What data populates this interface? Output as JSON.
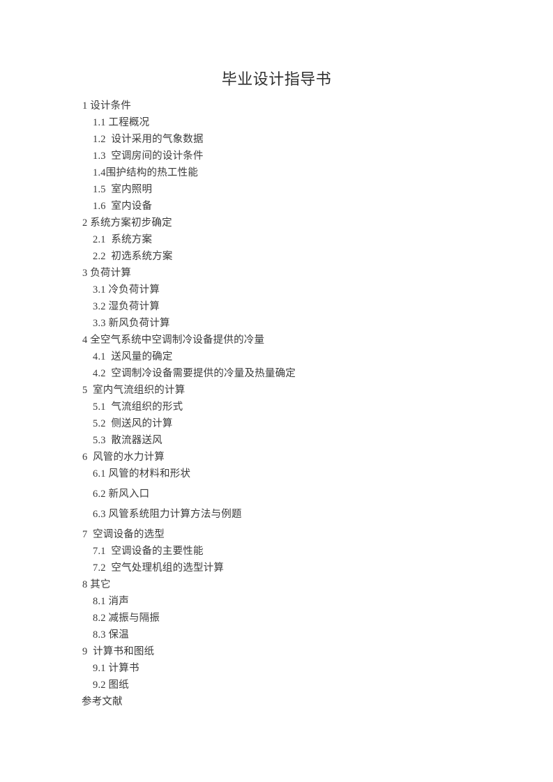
{
  "document": {
    "title": "毕业设计指导书",
    "toc": [
      {
        "text": "1 设计条件",
        "level": 1
      },
      {
        "text": "1.1 工程概况",
        "level": 2
      },
      {
        "text": "1.2  设计采用的气象数据",
        "level": 2
      },
      {
        "text": "1.3  空调房间的设计条件",
        "level": 2
      },
      {
        "text": "1.4围护结构的热工性能",
        "level": 2
      },
      {
        "text": "1.5  室内照明",
        "level": 2
      },
      {
        "text": "1.6  室内设备",
        "level": 2
      },
      {
        "text": "2 系统方案初步确定",
        "level": 1
      },
      {
        "text": "2.1  系统方案",
        "level": 2
      },
      {
        "text": "2.2  初选系统方案",
        "level": 2
      },
      {
        "text": "3 负荷计算",
        "level": 1
      },
      {
        "text": "3.1 冷负荷计算",
        "level": 2
      },
      {
        "text": "3.2 湿负荷计算",
        "level": 2
      },
      {
        "text": "3.3 新风负荷计算",
        "level": 2
      },
      {
        "text": "4 全空气系统中空调制冷设备提供的冷量",
        "level": 1
      },
      {
        "text": "4.1  送风量的确定",
        "level": 2
      },
      {
        "text": "4.2  空调制冷设备需要提供的冷量及热量确定",
        "level": 2
      },
      {
        "text": "5  室内气流组织的计算",
        "level": 1
      },
      {
        "text": "5.1  气流组织的形式",
        "level": 2
      },
      {
        "text": "5.2  侧送风的计算",
        "level": 2
      },
      {
        "text": "5.3  散流器送风",
        "level": 2
      },
      {
        "text": "6  风管的水力计算",
        "level": 1
      },
      {
        "text": "6.1 风管的材料和形状",
        "level": 2,
        "spacing": "gap-after"
      },
      {
        "text": "6.2 新风入口",
        "level": 2,
        "spacing": "gap-after"
      },
      {
        "text": "6.3 风管系统阻力计算方法与例题",
        "level": 2,
        "spacing": "gap-after"
      },
      {
        "text": "7  空调设备的选型",
        "level": 1
      },
      {
        "text": "7.1  空调设备的主要性能",
        "level": 2
      },
      {
        "text": "7.2  空气处理机组的选型计算",
        "level": 2
      },
      {
        "text": "8 其它",
        "level": 1
      },
      {
        "text": "8.1 消声",
        "level": 2
      },
      {
        "text": "8.2 减振与隔振",
        "level": 2
      },
      {
        "text": "8.3 保温",
        "level": 2
      },
      {
        "text": "9  计算书和图纸",
        "level": 1
      },
      {
        "text": "9.1 计算书",
        "level": 2
      },
      {
        "text": "9.2 图纸",
        "level": 2
      },
      {
        "text": "参考文献",
        "level": 0
      }
    ]
  }
}
